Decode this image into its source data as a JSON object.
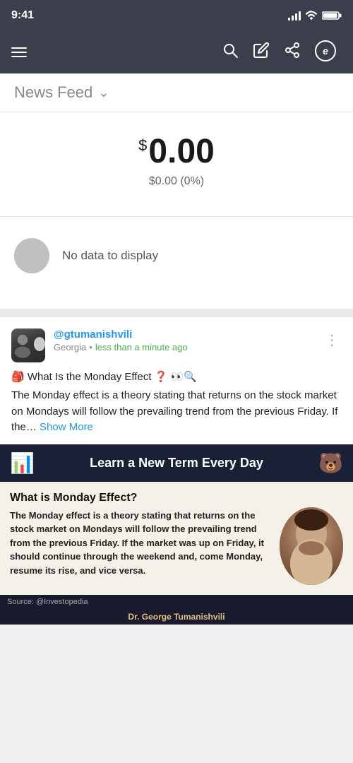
{
  "statusBar": {
    "time": "9:41",
    "batteryIcon": "🔋",
    "wifiIcon": "📶"
  },
  "navbar": {
    "menuIcon": "≡",
    "searchIcon": "🔍",
    "editIcon": "✏️",
    "shareIcon": "⬆",
    "profileIcon": "👤"
  },
  "feedHeader": {
    "title": "News Feed",
    "chevron": "∨"
  },
  "portfolio": {
    "currencySign": "$",
    "mainValue": "0.00",
    "changeValue": "$0.00 (0%)"
  },
  "noData": {
    "text": "No data to display"
  },
  "post": {
    "username": "@gtumanishvili",
    "location": "Georgia",
    "timeSeparator": "•",
    "time": "less than a minute ago",
    "menuDots": "⋮",
    "titleLine": "🎒 What Is the Monday Effect ❓ 👀🔍",
    "bodyText": "The Monday effect is a theory stating that returns on the stock market on Mondays will follow the prevailing trend from the previous Friday. If the…",
    "showMore": "Show More"
  },
  "postImage": {
    "bannerIcon": "📊",
    "bannerText": "Learn a New Term Every Day",
    "bannerIconRight": "🐻",
    "imageHeading": "What is Monday Effect?",
    "imageBody": "The Monday effect is a theory stating that returns on the stock market on Mondays will follow the prevailing trend from the previous Friday. If the market was up on Friday, it should continue through the weekend and, come Monday, resume its rise, and vice versa.",
    "sourceLabel": "Source: @Investopedia",
    "drName": "Dr. George Tumanishvili"
  }
}
